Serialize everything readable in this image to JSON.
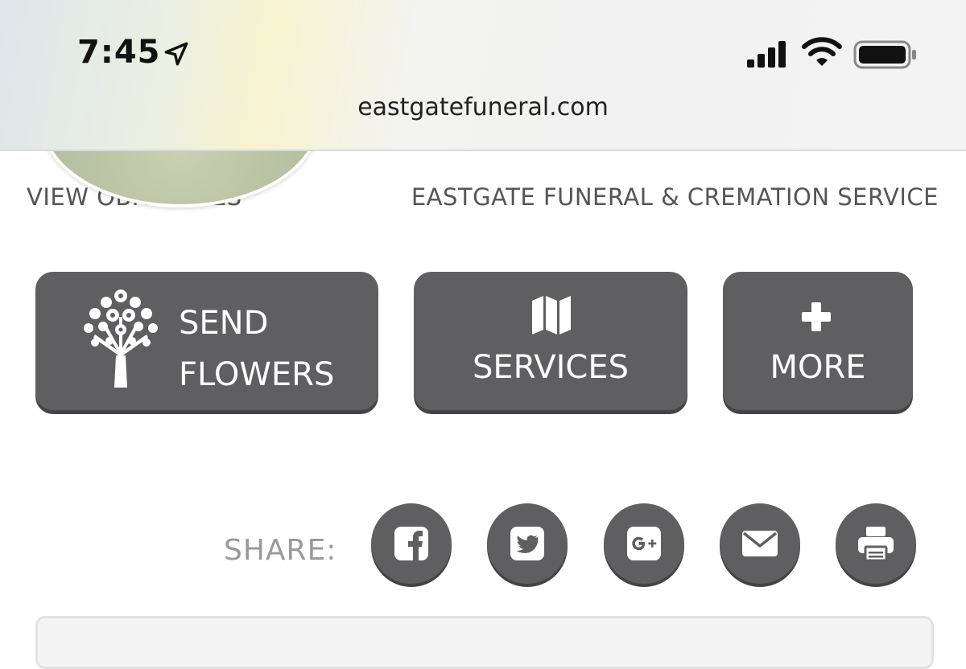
{
  "status_bar": {
    "time": "7:45",
    "icons": [
      "location-arrow-icon",
      "cellular-signal-icon",
      "wifi-icon",
      "battery-icon"
    ]
  },
  "address_bar": {
    "url": "eastgatefuneral.com"
  },
  "nav": {
    "left_link": "VIEW OBITUARIES",
    "right_link": "EASTGATE FUNERAL & CREMATION SERVICE"
  },
  "actions": {
    "send_flowers": {
      "line1": "SEND",
      "line2": "FLOWERS",
      "icon": "flower-bouquet-icon"
    },
    "services": {
      "label": "SERVICES",
      "icon": "map-icon"
    },
    "more": {
      "label": "MORE",
      "icon": "plus-icon"
    }
  },
  "share": {
    "label": "SHARE:",
    "buttons": [
      "facebook-icon",
      "twitter-icon",
      "google-plus-icon",
      "email-icon",
      "print-icon"
    ]
  },
  "colors": {
    "button_bg": "#5f5f61",
    "button_text": "#ffffff",
    "nav_text": "#555555",
    "share_label": "#9a9a9a"
  }
}
